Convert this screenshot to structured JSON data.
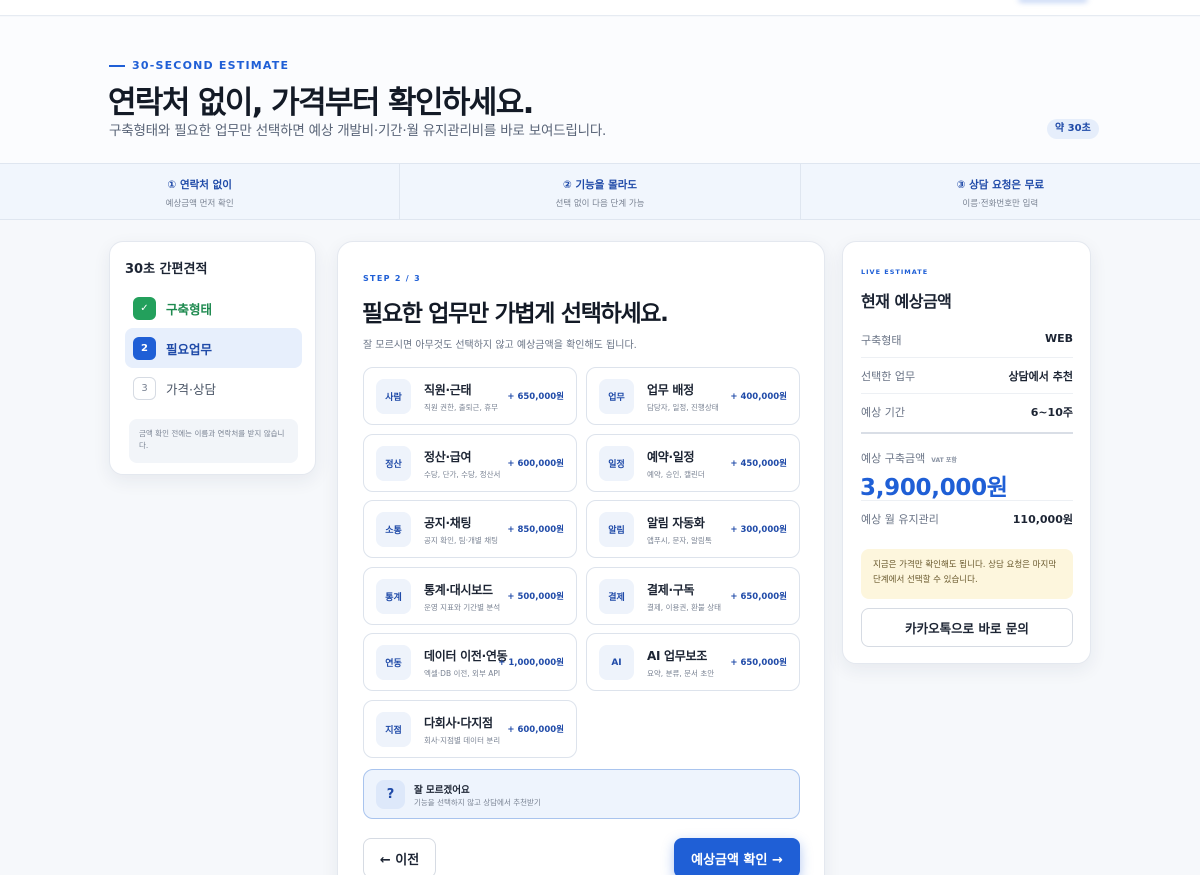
{
  "hero": {
    "eyebrow": "30-SECOND ESTIMATE",
    "title": "연락처 없이, 가격부터 확인하세요.",
    "subtitle": "구축형태와 필요한 업무만 선택하면 예상 개발비·기간·월 유지관리비를 바로 보여드립니다.",
    "time_badge": "약 30초"
  },
  "benefits": [
    {
      "title": "① 연락처 없이",
      "sub": "예상금액 먼저 확인"
    },
    {
      "title": "② 기능을 몰라도",
      "sub": "선택 없이 다음 단계 가능"
    },
    {
      "title": "③ 상담 요청은 무료",
      "sub": "이름·전화번호만 입력"
    }
  ],
  "steps": {
    "title": "30초 간편견적",
    "items": [
      {
        "num": "✓",
        "label": "구축형태",
        "state": "done"
      },
      {
        "num": "2",
        "label": "필요업무",
        "state": "active"
      },
      {
        "num": "3",
        "label": "가격·상담",
        "state": "todo"
      }
    ],
    "note": "금액 확인 전에는 이름과 연락처를 받지 않습니다."
  },
  "main": {
    "step_label": "STEP 2 / 3",
    "title": "필요한 업무만 가볍게 선택하세요.",
    "desc": "잘 모르시면 아무것도 선택하지 않고 예상금액을 확인해도 됩니다.",
    "options": [
      {
        "icon": "사람",
        "name": "직원·근태",
        "desc": "직원 권한, 출퇴근, 휴무",
        "price": "+ 650,000원"
      },
      {
        "icon": "업무",
        "name": "업무 배정",
        "desc": "담당자, 일정, 진행상태",
        "price": "+ 400,000원"
      },
      {
        "icon": "정산",
        "name": "정산·급여",
        "desc": "수당, 단가, 수당, 정산서",
        "price": "+ 600,000원"
      },
      {
        "icon": "일정",
        "name": "예약·일정",
        "desc": "예약, 승인, 캘린더",
        "price": "+ 450,000원"
      },
      {
        "icon": "소통",
        "name": "공지·채팅",
        "desc": "공지 확인, 팀·개별 채팅",
        "price": "+ 850,000원"
      },
      {
        "icon": "알림",
        "name": "알림 자동화",
        "desc": "앱푸시, 문자, 알림톡",
        "price": "+ 300,000원"
      },
      {
        "icon": "통계",
        "name": "통계·대시보드",
        "desc": "운영 지표와 기간별 분석",
        "price": "+ 500,000원"
      },
      {
        "icon": "결제",
        "name": "결제·구독",
        "desc": "결제, 이용권, 환불 상태",
        "price": "+ 650,000원"
      },
      {
        "icon": "연동",
        "name": "데이터 이전·연동",
        "desc": "엑셀·DB 이전, 외부 API",
        "price": "+ 1,000,000원"
      },
      {
        "icon": "AI",
        "name": "AI 업무보조",
        "desc": "요약, 분류, 문서 초안",
        "price": "+ 650,000원"
      },
      {
        "icon": "지점",
        "name": "다회사·다지점",
        "desc": "회사·지점별 데이터 분리",
        "price": "+ 600,000원"
      }
    ],
    "unsure": {
      "icon": "?",
      "title": "잘 모르겠어요",
      "sub": "기능을 선택하지 않고 상담에서 추천받기"
    },
    "prev_label": "← 이전",
    "next_label": "예상금액 확인 →"
  },
  "estimate": {
    "live": "LIVE ESTIMATE",
    "title": "현재 예상금액",
    "rows": [
      {
        "key": "구축형태",
        "value": "WEB"
      },
      {
        "key": "선택한 업무",
        "value": "상담에서 추천"
      },
      {
        "key": "예상 기간",
        "value": "6~10주"
      }
    ],
    "total_label": "예상 구축금액",
    "vat": "VAT 포함",
    "total": "3,900,000원",
    "monthly_label": "예상 월 유지관리",
    "monthly": "110,000원",
    "info": "지금은 가격만 확인해도 됩니다. 상담 요청은 마지막 단계에서 선택할 수 있습니다.",
    "kakao_label": "카카오톡으로 바로 문의"
  }
}
